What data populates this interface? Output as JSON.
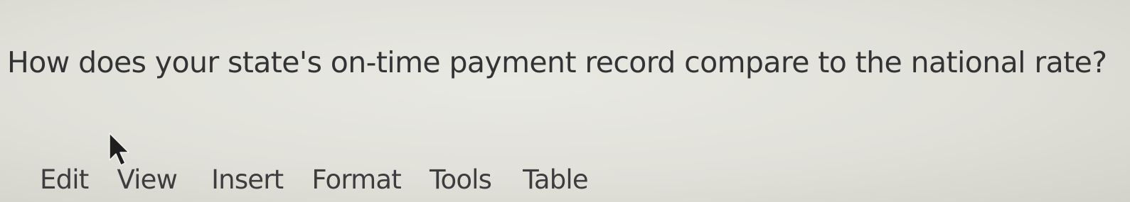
{
  "question": {
    "text": "How does your state's on-time payment record compare to the national rate?"
  },
  "menubar": {
    "items": [
      {
        "label": "Edit"
      },
      {
        "label": "View"
      },
      {
        "label": "Insert"
      },
      {
        "label": "Format"
      },
      {
        "label": "Tools"
      },
      {
        "label": "Table"
      }
    ]
  },
  "icons": {
    "cursor": "mouse-pointer-icon"
  },
  "colors": {
    "background": "#e3e3dc",
    "text": "#333335",
    "cursor": "#1e1e1e"
  }
}
